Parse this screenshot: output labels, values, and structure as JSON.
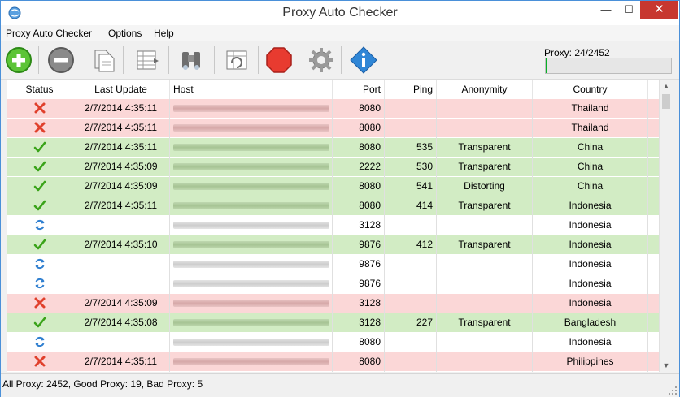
{
  "window": {
    "title": "Proxy Auto Checker",
    "close_symbol": "✕",
    "maximize_symbol": "☐",
    "minimize_symbol": "—"
  },
  "menu": {
    "items": [
      "Proxy Auto Checker",
      "Options",
      "Help"
    ]
  },
  "toolbar": {
    "buttons": [
      {
        "name": "add",
        "icon": "add-circle-icon"
      },
      {
        "name": "remove",
        "icon": "remove-circle-icon"
      },
      {
        "name": "copy",
        "icon": "copy-icon"
      },
      {
        "name": "export",
        "icon": "export-table-icon"
      },
      {
        "name": "find",
        "icon": "binoculars-icon"
      },
      {
        "name": "refresh",
        "icon": "refresh-table-icon"
      },
      {
        "name": "stop",
        "icon": "stop-icon"
      },
      {
        "name": "settings",
        "icon": "gear-icon"
      },
      {
        "name": "about",
        "icon": "info-icon"
      }
    ],
    "proxy_label": "Proxy: 24/2452",
    "progress_fraction": 0.0098
  },
  "table": {
    "columns": [
      "Status",
      "Last Update",
      "Host",
      "Port",
      "Ping",
      "Anonymity",
      "Country"
    ],
    "rows": [
      {
        "status": "bad",
        "last_update": "2/7/2014 4:35:11",
        "port": "8080",
        "ping": "",
        "anonymity": "",
        "country": "Thailand"
      },
      {
        "status": "bad",
        "last_update": "2/7/2014 4:35:11",
        "port": "8080",
        "ping": "",
        "anonymity": "",
        "country": "Thailand"
      },
      {
        "status": "good",
        "last_update": "2/7/2014 4:35:11",
        "port": "8080",
        "ping": "535",
        "anonymity": "Transparent",
        "country": "China"
      },
      {
        "status": "good",
        "last_update": "2/7/2014 4:35:09",
        "port": "2222",
        "ping": "530",
        "anonymity": "Transparent",
        "country": "China"
      },
      {
        "status": "good",
        "last_update": "2/7/2014 4:35:09",
        "port": "8080",
        "ping": "541",
        "anonymity": "Distorting",
        "country": "China"
      },
      {
        "status": "good",
        "last_update": "2/7/2014 4:35:11",
        "port": "8080",
        "ping": "414",
        "anonymity": "Transparent",
        "country": "Indonesia"
      },
      {
        "status": "checking",
        "last_update": "",
        "port": "3128",
        "ping": "",
        "anonymity": "",
        "country": "Indonesia"
      },
      {
        "status": "good",
        "last_update": "2/7/2014 4:35:10",
        "port": "9876",
        "ping": "412",
        "anonymity": "Transparent",
        "country": "Indonesia"
      },
      {
        "status": "checking",
        "last_update": "",
        "port": "9876",
        "ping": "",
        "anonymity": "",
        "country": "Indonesia"
      },
      {
        "status": "checking",
        "last_update": "",
        "port": "9876",
        "ping": "",
        "anonymity": "",
        "country": "Indonesia"
      },
      {
        "status": "bad",
        "last_update": "2/7/2014 4:35:09",
        "port": "3128",
        "ping": "",
        "anonymity": "",
        "country": "Indonesia"
      },
      {
        "status": "good",
        "last_update": "2/7/2014 4:35:08",
        "port": "3128",
        "ping": "227",
        "anonymity": "Transparent",
        "country": "Bangladesh"
      },
      {
        "status": "checking",
        "last_update": "",
        "port": "8080",
        "ping": "",
        "anonymity": "",
        "country": "Indonesia"
      },
      {
        "status": "bad",
        "last_update": "2/7/2014 4:35:11",
        "port": "8080",
        "ping": "",
        "anonymity": "",
        "country": "Philippines"
      }
    ]
  },
  "colors": {
    "good_row": "#d2ecc4",
    "bad_row": "#fbd7d7",
    "checking_row": "#ffffff",
    "progress": "#06b025"
  },
  "scrollbar": {
    "up_symbol": "▲",
    "down_symbol": "▼"
  },
  "statusbar": {
    "text": "All Proxy: 2452, Good Proxy: 19, Bad Proxy: 5"
  }
}
